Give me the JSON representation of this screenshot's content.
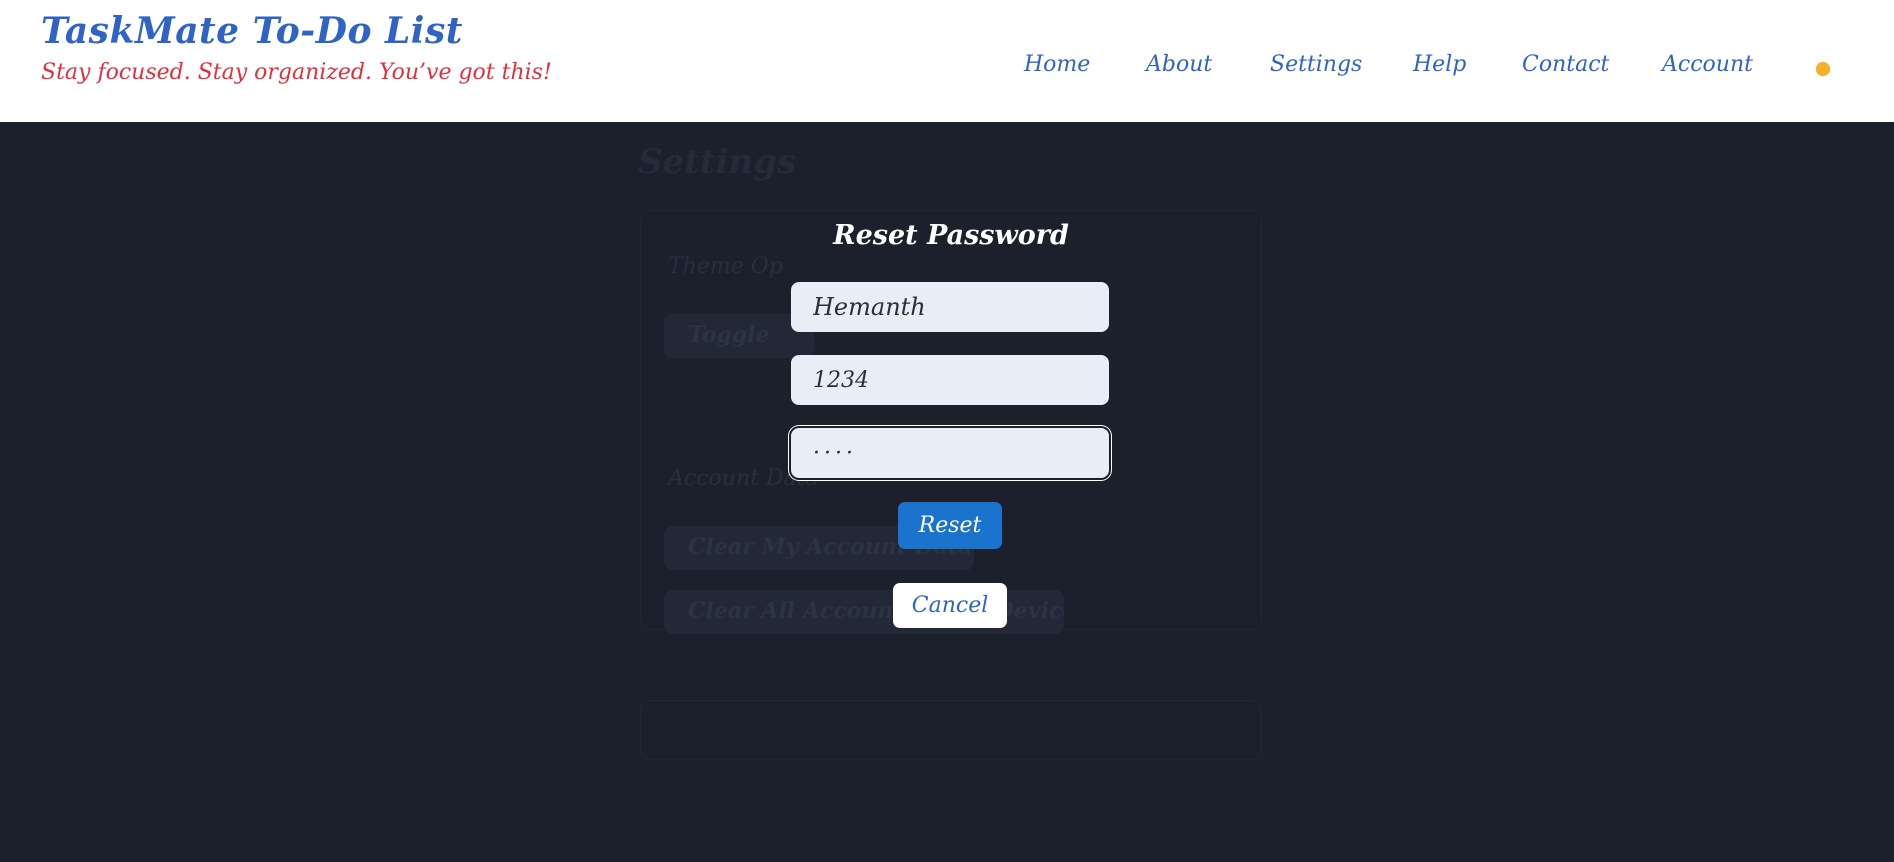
{
  "header": {
    "title": "TaskMate To-Do List",
    "tagline": "Stay focused. Stay organized. You’ve got this!",
    "nav": {
      "home": "Home",
      "about": "About",
      "settings": "Settings",
      "help": "Help",
      "contact": "Contact",
      "account": "Account"
    },
    "theme_icon": "sun-icon"
  },
  "background": {
    "settings_title": "Settings",
    "theme_label": "Theme Op",
    "toggle_button": "Toggle",
    "account_label": "Account Data",
    "clear_button": "Clear My Account Data",
    "clear_all_button": "Clear All Accounts (This Device)"
  },
  "modal": {
    "title": "Reset Password",
    "username_value": "Hemanth",
    "old_password_value": "1234",
    "new_password_value": "····",
    "reset_label": "Reset",
    "cancel_label": "Cancel"
  },
  "colors": {
    "brand": "#2f63c6",
    "tagline": "#e0303e",
    "backdrop": "#1c202d",
    "primary_button": "#1a73cc"
  }
}
